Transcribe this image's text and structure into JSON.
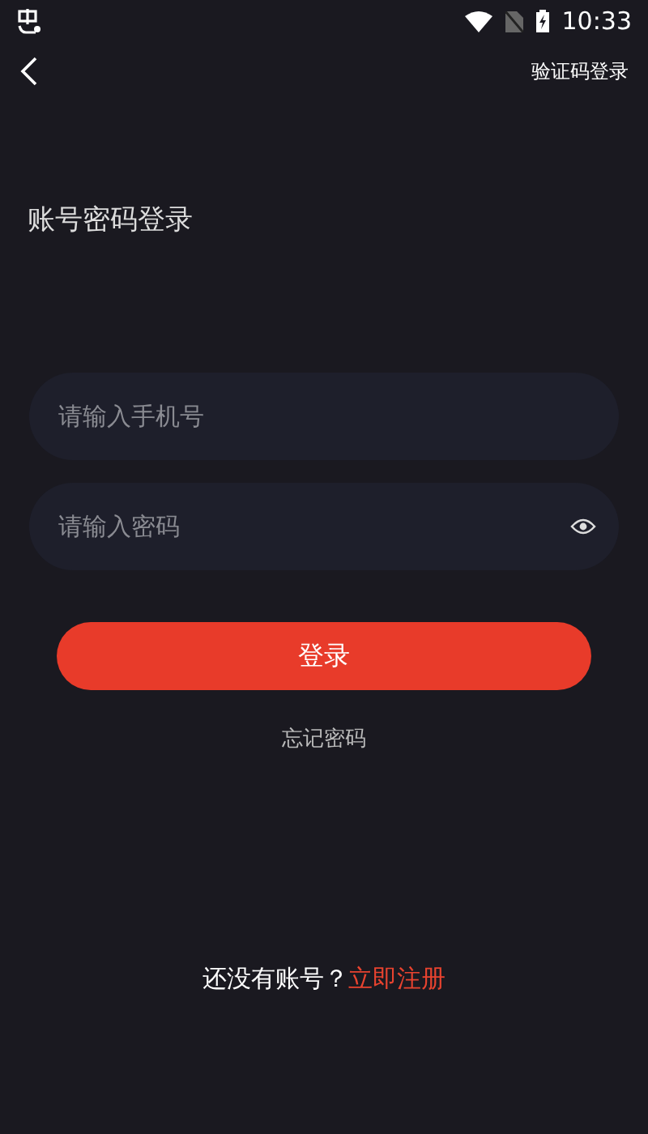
{
  "status_bar": {
    "time": "10:33"
  },
  "header": {
    "action": "验证码登录"
  },
  "title": "账号密码登录",
  "fields": [
    {
      "kind": "phone",
      "placeholder": "请输入手机号"
    },
    {
      "kind": "password",
      "placeholder": "请输入密码"
    }
  ],
  "login_button": "登录",
  "forgot_link": "忘记密码",
  "register": {
    "prompt": "还没有账号？",
    "link": "立即注册"
  }
}
